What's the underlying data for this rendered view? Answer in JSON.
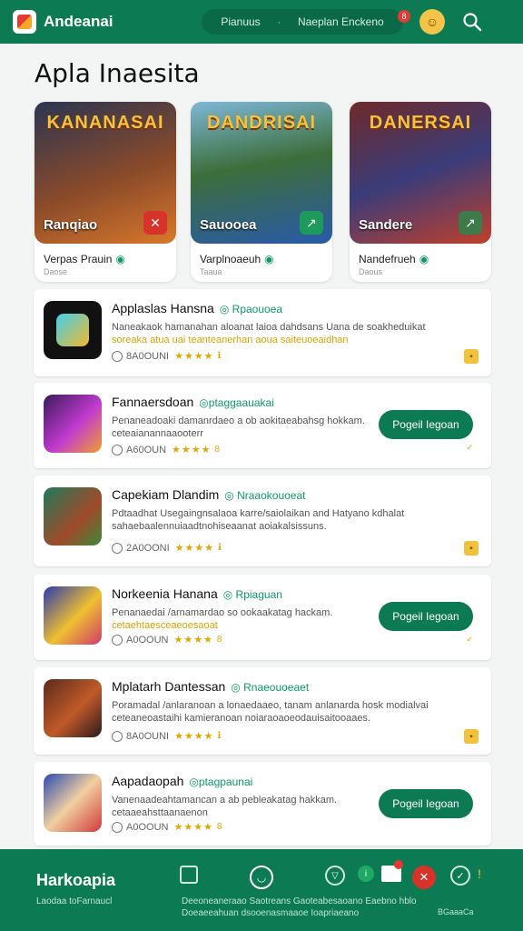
{
  "header": {
    "brand": "Andeanai",
    "tab_a": "Pianuus",
    "tab_b": "Naeplan Enckeno",
    "notif_count": "8"
  },
  "page_title": "Apla Inaesita",
  "featured": [
    {
      "art_title": "KANANASAI",
      "label": "Ranqiao",
      "name": "Verpas Prauin",
      "sub": "Daose",
      "btn": "✕"
    },
    {
      "art_title": "DANDRISAI",
      "label": "Sauooea",
      "name": "Varplnoaeuh",
      "sub": "Taaua",
      "btn": "↗"
    },
    {
      "art_title": "DANERSAI",
      "label": "Sandere",
      "name": "Nandefrueh",
      "sub": "Daous",
      "btn": "↗"
    }
  ],
  "apps": [
    {
      "name": "Applaslas Hansna",
      "tag": "◎ Rpaouoea",
      "desc": "Naneakaok hamanahan aloanat laioa dahdsans Uana de soakheduikat",
      "desc_hl": "soreaka atua uai teanteanerhan aoua saiteuoeaidhan",
      "downloads": "8A0OUNI",
      "stars": "★★★★",
      "tail": "ℹ",
      "action": "badge"
    },
    {
      "name": "Fannaersdoan",
      "tag": "◎ptaggaauakai",
      "desc": "Penaneadoaki damanrdaeo a ob aokitaeabahsg hokkam.",
      "desc_hl": "ceteaianannaaooterr",
      "downloads": "A60OUN",
      "stars": "★★★★",
      "tail": "8",
      "action": "get",
      "button": "Pogeil Iegoan"
    },
    {
      "name": "Capekiam Dlandim",
      "tag": "◎ Nraaokouoeat",
      "desc": "Pdtaadhat Usegaingnsalaoa karre/saiolaikan and Hatyano kdhalat sahaebaalennuiaadtnohiseaanat aoiakalsissuns.",
      "desc_hl": "",
      "downloads": "2A0OONI",
      "stars": "★★★★",
      "tail": "ℹ",
      "action": "badge"
    },
    {
      "name": "Norkeenia Hanana",
      "tag": "◎ Rpiaguan",
      "desc": "Penanaedai /arnamardao so ookaakatag hackam.",
      "desc_hl": "cetaehtaesceaeoesaoat",
      "downloads": "A0OOUN",
      "stars": "★★★★",
      "tail": "8",
      "action": "get",
      "button": "Pogeil Iegoan"
    },
    {
      "name": "Mplatarh Dantessan",
      "tag": "◎ Rnaeouoeaet",
      "desc": "Poramadal /anlaranoan a lonaedaaeo, tanam anlanarda hosk modialvai ceteaneoastaihi kamieranoan noiaraoaoeodauisaitooaaes.",
      "desc_hl": "",
      "downloads": "8A0OUNI",
      "stars": "★★★★",
      "tail": "ℹ",
      "action": "badge"
    },
    {
      "name": "Aapadaopah",
      "tag": "◎ptagpaunai",
      "desc": "Vanenaadeahtamancan a ab pebleakatag hakkam.",
      "desc_hl": "cetaaeahsttaanaenon",
      "downloads": "A0OOUN",
      "stars": "★★★★",
      "tail": "8",
      "action": "get",
      "button": "Pogeil Iegoan"
    }
  ],
  "footer": {
    "brand": "Harkoapia",
    "sub": "Laodaa toFarnaucl",
    "text1": "Deeoneaneraao Saotreans Gaoteabesaoano Eaebno hblo",
    "text2": "Doeaeeahuan dsooenasmaaoe Ioapriaeano",
    "text3": "BGaaaCa"
  },
  "colors": {
    "primary": "#0c7a52",
    "accent": "#e0a800",
    "background": "#f3f5f4"
  },
  "icons": [
    "app-logo-icon",
    "search-icon",
    "avatar-icon",
    "notification-badge",
    "verified-icon",
    "star-icon",
    "bookmark-icon",
    "download-icon",
    "home-icon",
    "chat-icon",
    "close-icon",
    "settings-icon"
  ]
}
